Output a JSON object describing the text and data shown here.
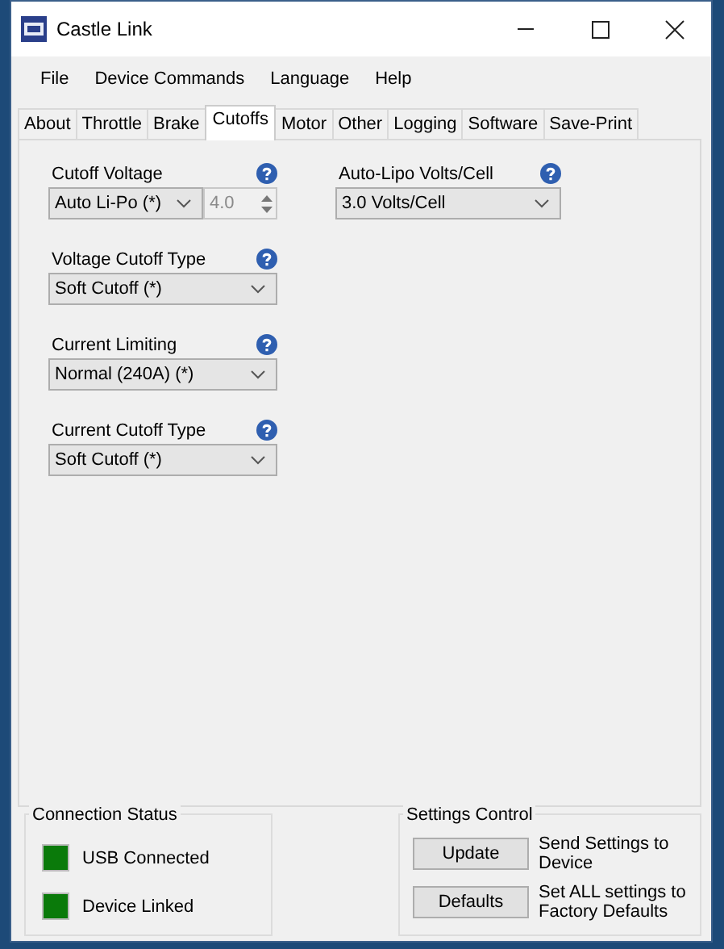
{
  "window": {
    "title": "Castle Link"
  },
  "menu": [
    "File",
    "Device Commands",
    "Language",
    "Help"
  ],
  "tabs": [
    {
      "label": "About",
      "selected": false
    },
    {
      "label": "Throttle",
      "selected": false
    },
    {
      "label": "Brake",
      "selected": false
    },
    {
      "label": "Cutoffs",
      "selected": true
    },
    {
      "label": "Motor",
      "selected": false
    },
    {
      "label": "Other",
      "selected": false
    },
    {
      "label": "Logging",
      "selected": false
    },
    {
      "label": "Software",
      "selected": false
    },
    {
      "label": "Save-Print",
      "selected": false
    }
  ],
  "columns": [
    [
      {
        "label": "Cutoff Voltage",
        "kind": "combo-spinner",
        "value": "Auto Li-Po (*)",
        "spinner": {
          "value": "4.0",
          "disabled": true
        }
      },
      {
        "label": "Voltage Cutoff Type",
        "kind": "combo",
        "value": "Soft Cutoff (*)"
      },
      {
        "label": "Current Limiting",
        "kind": "combo",
        "value": "Normal (240A) (*)"
      },
      {
        "label": "Current Cutoff Type",
        "kind": "combo",
        "value": "Soft Cutoff (*)"
      }
    ],
    [
      {
        "label": "Auto-Lipo Volts/Cell",
        "kind": "combo",
        "value": "3.0 Volts/Cell"
      }
    ]
  ],
  "connection_status": {
    "title": "Connection Status",
    "items": [
      {
        "label": "USB Connected",
        "color": "#0a7a0a"
      },
      {
        "label": "Device Linked",
        "color": "#0a7a0a"
      }
    ]
  },
  "settings_control": {
    "title": "Settings Control",
    "actions": [
      {
        "button": "Update",
        "description": "Send Settings to Device"
      },
      {
        "button": "Defaults",
        "description": "Set ALL settings to Factory Defaults"
      }
    ]
  }
}
